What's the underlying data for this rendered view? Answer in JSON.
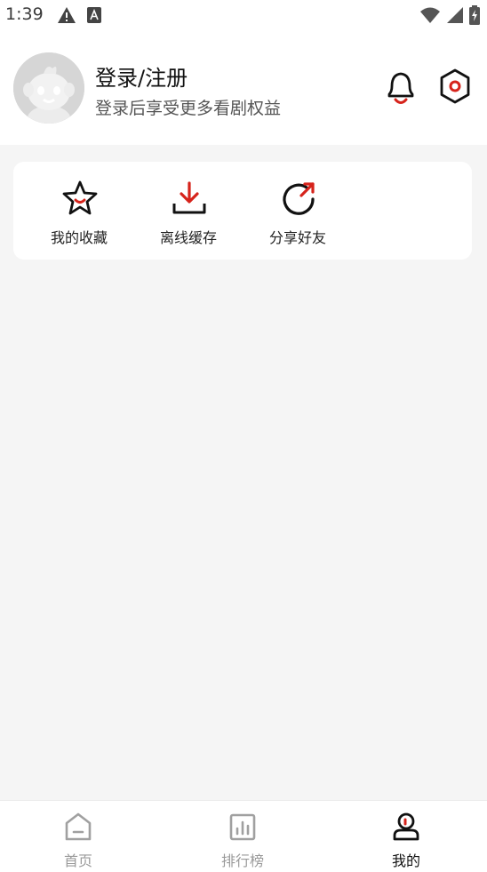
{
  "status_bar": {
    "time": "1:39",
    "left_icons": [
      "warning-icon",
      "font-a-icon"
    ],
    "right_icons": [
      "wifi-icon",
      "signal-icon",
      "battery-charging-icon"
    ]
  },
  "profile": {
    "title": "登录/注册",
    "subtitle": "登录后享受更多看剧权益",
    "avatar_icon": "avatar-mascot-icon",
    "actions": [
      "bell-icon",
      "settings-hexagon-icon"
    ]
  },
  "quick_actions": [
    {
      "label": "我的收藏",
      "icon": "star-icon"
    },
    {
      "label": "离线缓存",
      "icon": "download-icon"
    },
    {
      "label": "分享好友",
      "icon": "share-icon"
    }
  ],
  "tabs": [
    {
      "label": "首页",
      "icon": "home-icon",
      "active": false
    },
    {
      "label": "排行榜",
      "icon": "ranking-icon",
      "active": false
    },
    {
      "label": "我的",
      "icon": "profile-icon",
      "active": true
    }
  ],
  "colors": {
    "accent": "#d6231b",
    "background": "#f5f5f5",
    "card": "#ffffff",
    "inactive": "#9a9a9a"
  }
}
